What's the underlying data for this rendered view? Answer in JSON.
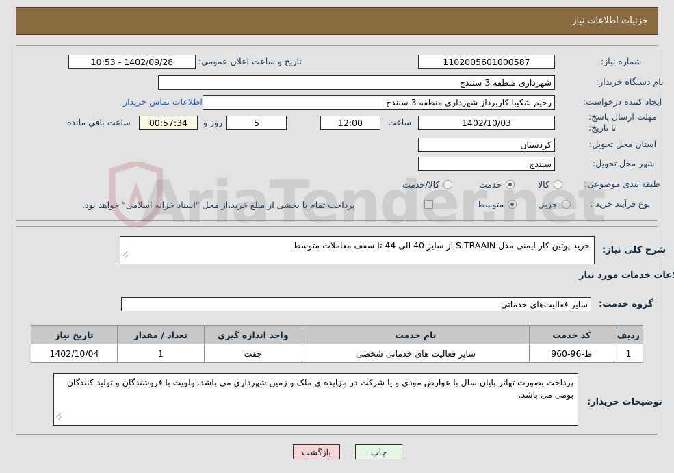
{
  "header": {
    "title": "جزئیات اطلاعات نیاز",
    "bg": "#8b6b43"
  },
  "watermark": {
    "text": "AriaTender.net"
  },
  "form": {
    "need_number_label": "شماره نیاز:",
    "need_number_value": "1102005601000587",
    "buyer_org_label": "نام دستگاه خریدار:",
    "buyer_org_value": "شهرداری منطقه 3 سنندج",
    "creator_label": "ایجاد کننده درخواست:",
    "creator_value": "رحیم شکیبا کاربرداز شهرداری منطقه 3 سنندج",
    "contact_link": "اطلاعات تماس خریدار",
    "deadline_label": "مهلت ارسال پاسخ: تا تاریخ:",
    "deadline_date": "1402/10/03",
    "deadline_hour_label": "ساعت",
    "deadline_hour": "12:00",
    "remaining_days": "5",
    "remaining_days_label": "روز و",
    "remaining_clock": "00:57:34",
    "remaining_clock_label": "ساعت باقي مانده",
    "announce_label": "تاریخ و ساعت اعلان عمومي:",
    "announce_value": "1402/09/28 - 10:53",
    "province_label": "استان محل تحویل:",
    "province_value": "کردستان",
    "city_label": "شهر محل تحویل:",
    "city_value": "سنندج",
    "category_label": "طبقه بندی موضوعی:",
    "category_options": [
      {
        "label": "کالا",
        "selected": false
      },
      {
        "label": "خدمت",
        "selected": true
      },
      {
        "label": "کالا/خدمت",
        "selected": false
      }
    ],
    "process_label": "نوع فرآیند خرید :",
    "process_options": [
      {
        "label": "جزیي",
        "selected": false
      },
      {
        "label": "متوسط",
        "selected": true
      }
    ],
    "treasury_checkbox_checked": false,
    "treasury_text": "پرداخت تمام یا بخشی از مبلغ خرید،از محل \"اسناد خزانه اسلامی\" خواهد بود."
  },
  "details": {
    "need_desc_label": "شرح کلی نیاز:",
    "need_desc_value": "خرید پوتین کار ایمنی مدل S.TRAAIN  از سایز 40 الی 44 تا سقف معاملات متوسط",
    "services_title": "اطلاعات خدمات مورد نیاز",
    "service_group_label": "گروه خدمت:",
    "service_group_value": "سایر فعالیت‌های خدماتی",
    "buyer_notes_label": "توضیحات خریدار:",
    "buyer_notes_value": "پرداخت بصورت تهاتر پایان سال با عوارض مودی و یا شرکت در مزایده ی ملک و زمین شهرداری می باشد.اولویت با فروشندگان و تولید کنندگان بومی می باشد."
  },
  "table": {
    "columns": [
      "ردیف",
      "کد خدمت",
      "نام خدمت",
      "واحد اندازه گیری",
      "تعداد / مقدار",
      "تاریخ نیاز"
    ],
    "rows": [
      {
        "row_no": "1",
        "service_code": "ط-96-960",
        "service_name": "سایر فعالیت های خدماتی شخصی",
        "unit": "جفت",
        "quantity": "1",
        "need_date": "1402/10/04"
      }
    ]
  },
  "buttons": {
    "print": "چاپ",
    "back": "بازگشت"
  }
}
